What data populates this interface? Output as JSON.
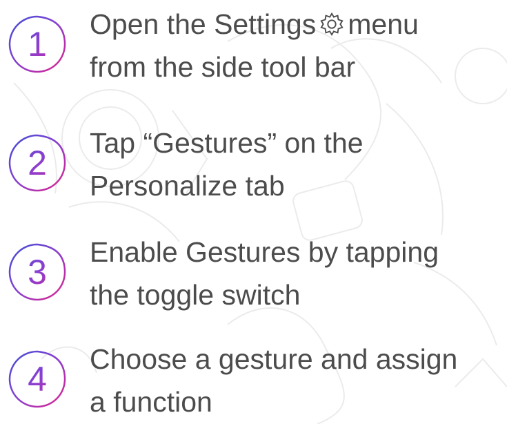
{
  "steps": [
    {
      "number": "1",
      "line1_before_icon": "Open the Settings",
      "icon": "gear-icon",
      "line1_after_icon": "menu",
      "line2": "from the side tool bar"
    },
    {
      "number": "2",
      "line1": "Tap “Gestures” on the",
      "line2": "Personalize tab"
    },
    {
      "number": "3",
      "line1": "Enable Gestures by tapping",
      "line2": "the toggle switch"
    },
    {
      "number": "4",
      "line1": "Choose a gesture and assign",
      "line2": "a function"
    }
  ],
  "colors": {
    "text": "#4c4c4c",
    "gradient_start": "#3f4fd6",
    "gradient_mid": "#8a3fd0",
    "gradient_end": "#e0238a",
    "doodle": "#ececec"
  }
}
